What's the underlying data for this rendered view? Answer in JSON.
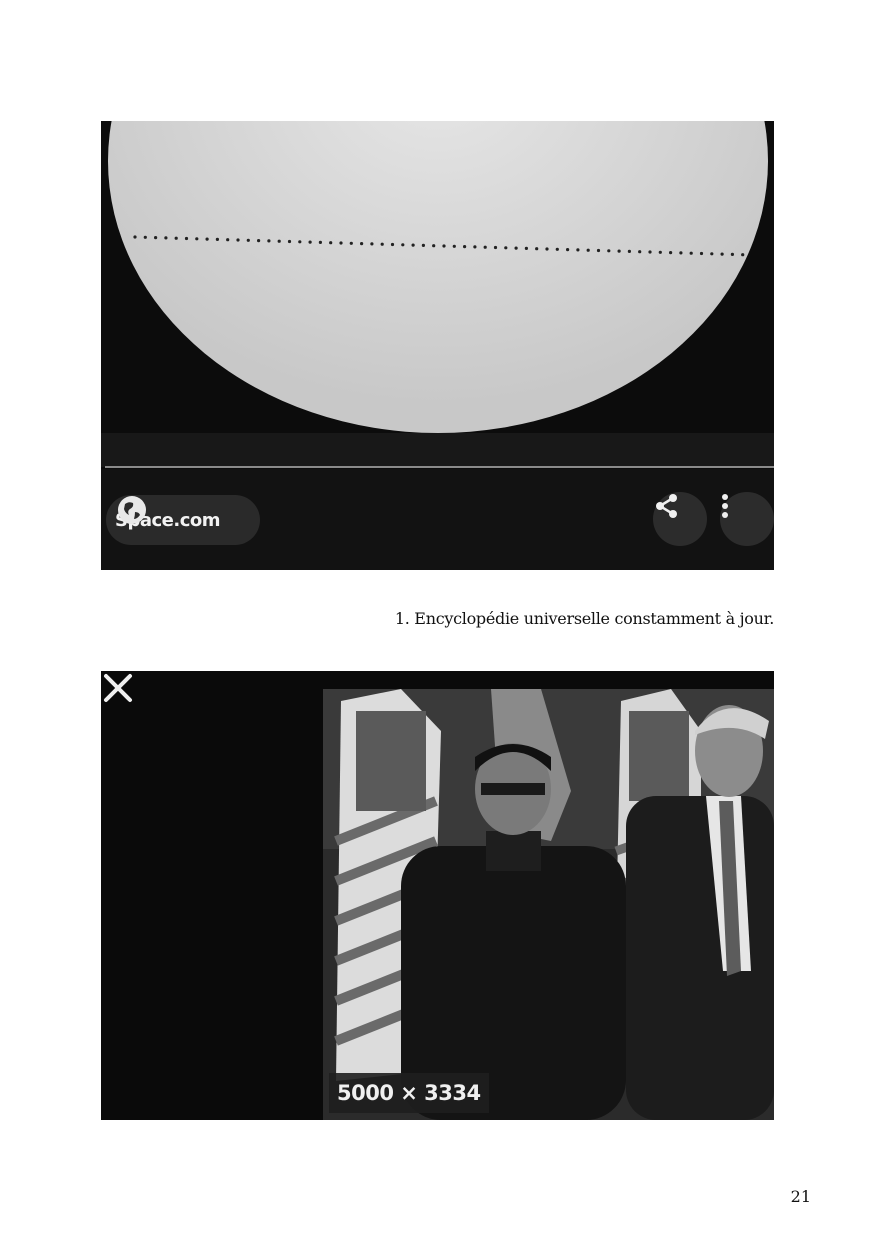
{
  "figure1": {
    "source_label": "Space.com",
    "icons": [
      "globe-icon",
      "share-icon",
      "more-vert-icon"
    ]
  },
  "caption": "1. Encyclopédie universelle constamment à jour.",
  "figure2": {
    "dimensions": "5000 × 3334",
    "icons": [
      "close-icon"
    ]
  },
  "page_number": "21"
}
